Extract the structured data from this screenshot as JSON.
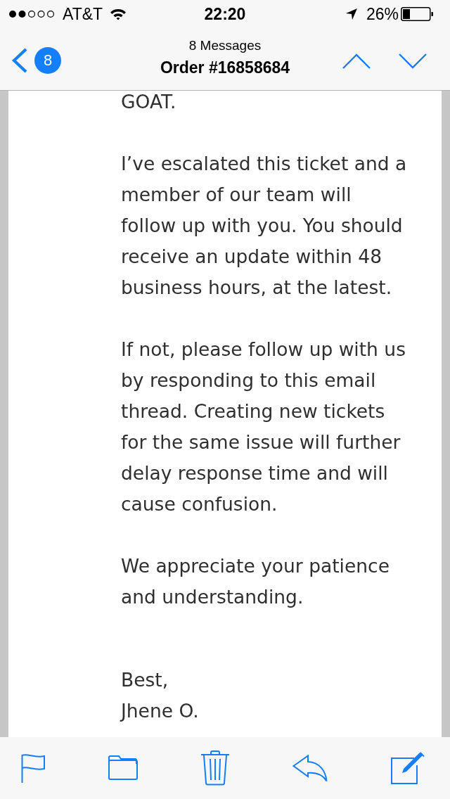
{
  "status_bar": {
    "carrier": "AT&T",
    "time": "22:20",
    "battery": "26%"
  },
  "nav": {
    "back_badge": "8",
    "subtitle": "8 Messages",
    "title": "Order #16858684"
  },
  "message": {
    "paragraphs": [
      {
        "lines": [
          "GOAT."
        ]
      },
      {
        "lines": [
          "I’ve escalated this ticket and a",
          "member of our team will",
          "follow up with you. You should",
          "receive an update within 48",
          "business hours, at the latest."
        ]
      },
      {
        "lines": [
          "If not, please follow up with us",
          "by responding to this email",
          "thread. Creating new tickets",
          "for the same issue will further",
          "delay response time and will",
          "cause confusion."
        ]
      },
      {
        "lines": [
          "We appreciate your patience",
          "and understanding."
        ]
      }
    ],
    "closing": "Best,",
    "signature": "Jhene O."
  }
}
